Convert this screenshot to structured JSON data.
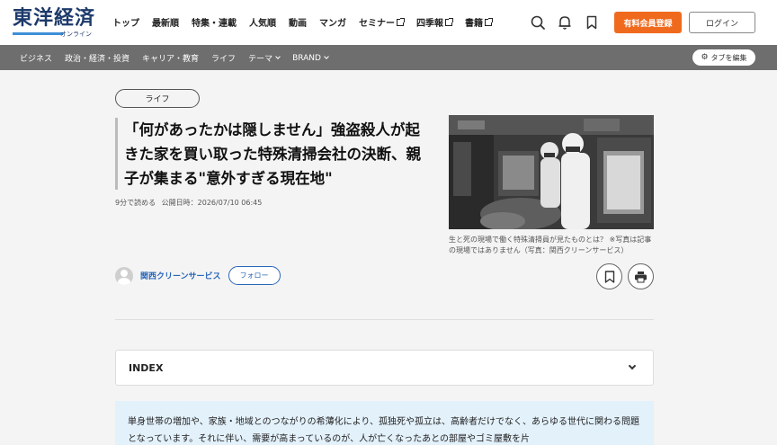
{
  "header": {
    "logo_text": "東洋経済",
    "logo_sub": "オンライン",
    "nav": [
      {
        "label": "トップ",
        "external": false
      },
      {
        "label": "最新順",
        "external": false
      },
      {
        "label": "特集・連載",
        "external": false
      },
      {
        "label": "人気順",
        "external": false
      },
      {
        "label": "動画",
        "external": false
      },
      {
        "label": "マンガ",
        "external": false
      },
      {
        "label": "セミナー",
        "external": true
      },
      {
        "label": "四季報",
        "external": true
      },
      {
        "label": "書籍",
        "external": true
      }
    ],
    "icons": [
      "search-icon",
      "bell-icon",
      "bookmark-icon"
    ],
    "register_label": "有料会員登録",
    "login_label": "ログイン",
    "accent_color": "#f06a1e",
    "brand_color": "#1d3a6b"
  },
  "subnav": {
    "items": [
      {
        "label": "ビジネス"
      },
      {
        "label": "政治・経済・投資"
      },
      {
        "label": "キャリア・教育"
      },
      {
        "label": "ライフ"
      },
      {
        "label": "テーマ",
        "dropdown": true
      },
      {
        "label": "BRAND",
        "dropdown": true
      }
    ],
    "tab_edit_label": "タブを編集"
  },
  "article": {
    "category": "ライフ",
    "title": "「何があったかは隠しません」強盗殺人が起きた家を買い取った特殊清掃会社の決断、親子が集まる\"意外すぎる現在地\"",
    "read_time": "9分で読める",
    "published_label": "公開日時：2026/07/10 06:45",
    "photo_caption": "生と死の現場で働く特殊清掃員が見たものとは？ ※写真は記事の現場ではありません（写真：関西クリーンサービス）",
    "author_name": "関西クリーンサービス",
    "follow_label": "フォロー",
    "index_label": "INDEX",
    "lead_text": "単身世帯の増加や、家族・地域とのつながりの希薄化により、孤独死や孤立は、高齢者だけでなく、あらゆる世代に関わる問題となっています。それに伴い、需要が高まっているのが、人が亡くなったあとの部屋やゴミ屋敷を片"
  }
}
